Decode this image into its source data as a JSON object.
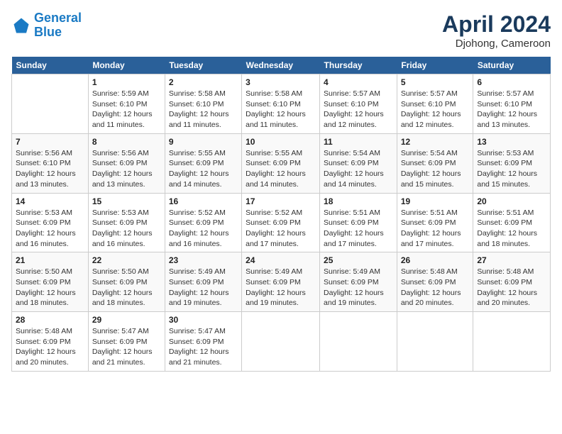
{
  "header": {
    "logo_line1": "General",
    "logo_line2": "Blue",
    "month_title": "April 2024",
    "location": "Djohong, Cameroon"
  },
  "days_of_week": [
    "Sunday",
    "Monday",
    "Tuesday",
    "Wednesday",
    "Thursday",
    "Friday",
    "Saturday"
  ],
  "weeks": [
    [
      {
        "day": "",
        "sunrise": "",
        "sunset": "",
        "daylight": ""
      },
      {
        "day": "1",
        "sunrise": "Sunrise: 5:59 AM",
        "sunset": "Sunset: 6:10 PM",
        "daylight": "Daylight: 12 hours and 11 minutes."
      },
      {
        "day": "2",
        "sunrise": "Sunrise: 5:58 AM",
        "sunset": "Sunset: 6:10 PM",
        "daylight": "Daylight: 12 hours and 11 minutes."
      },
      {
        "day": "3",
        "sunrise": "Sunrise: 5:58 AM",
        "sunset": "Sunset: 6:10 PM",
        "daylight": "Daylight: 12 hours and 11 minutes."
      },
      {
        "day": "4",
        "sunrise": "Sunrise: 5:57 AM",
        "sunset": "Sunset: 6:10 PM",
        "daylight": "Daylight: 12 hours and 12 minutes."
      },
      {
        "day": "5",
        "sunrise": "Sunrise: 5:57 AM",
        "sunset": "Sunset: 6:10 PM",
        "daylight": "Daylight: 12 hours and 12 minutes."
      },
      {
        "day": "6",
        "sunrise": "Sunrise: 5:57 AM",
        "sunset": "Sunset: 6:10 PM",
        "daylight": "Daylight: 12 hours and 13 minutes."
      }
    ],
    [
      {
        "day": "7",
        "sunrise": "Sunrise: 5:56 AM",
        "sunset": "Sunset: 6:10 PM",
        "daylight": "Daylight: 12 hours and 13 minutes."
      },
      {
        "day": "8",
        "sunrise": "Sunrise: 5:56 AM",
        "sunset": "Sunset: 6:09 PM",
        "daylight": "Daylight: 12 hours and 13 minutes."
      },
      {
        "day": "9",
        "sunrise": "Sunrise: 5:55 AM",
        "sunset": "Sunset: 6:09 PM",
        "daylight": "Daylight: 12 hours and 14 minutes."
      },
      {
        "day": "10",
        "sunrise": "Sunrise: 5:55 AM",
        "sunset": "Sunset: 6:09 PM",
        "daylight": "Daylight: 12 hours and 14 minutes."
      },
      {
        "day": "11",
        "sunrise": "Sunrise: 5:54 AM",
        "sunset": "Sunset: 6:09 PM",
        "daylight": "Daylight: 12 hours and 14 minutes."
      },
      {
        "day": "12",
        "sunrise": "Sunrise: 5:54 AM",
        "sunset": "Sunset: 6:09 PM",
        "daylight": "Daylight: 12 hours and 15 minutes."
      },
      {
        "day": "13",
        "sunrise": "Sunrise: 5:53 AM",
        "sunset": "Sunset: 6:09 PM",
        "daylight": "Daylight: 12 hours and 15 minutes."
      }
    ],
    [
      {
        "day": "14",
        "sunrise": "Sunrise: 5:53 AM",
        "sunset": "Sunset: 6:09 PM",
        "daylight": "Daylight: 12 hours and 16 minutes."
      },
      {
        "day": "15",
        "sunrise": "Sunrise: 5:53 AM",
        "sunset": "Sunset: 6:09 PM",
        "daylight": "Daylight: 12 hours and 16 minutes."
      },
      {
        "day": "16",
        "sunrise": "Sunrise: 5:52 AM",
        "sunset": "Sunset: 6:09 PM",
        "daylight": "Daylight: 12 hours and 16 minutes."
      },
      {
        "day": "17",
        "sunrise": "Sunrise: 5:52 AM",
        "sunset": "Sunset: 6:09 PM",
        "daylight": "Daylight: 12 hours and 17 minutes."
      },
      {
        "day": "18",
        "sunrise": "Sunrise: 5:51 AM",
        "sunset": "Sunset: 6:09 PM",
        "daylight": "Daylight: 12 hours and 17 minutes."
      },
      {
        "day": "19",
        "sunrise": "Sunrise: 5:51 AM",
        "sunset": "Sunset: 6:09 PM",
        "daylight": "Daylight: 12 hours and 17 minutes."
      },
      {
        "day": "20",
        "sunrise": "Sunrise: 5:51 AM",
        "sunset": "Sunset: 6:09 PM",
        "daylight": "Daylight: 12 hours and 18 minutes."
      }
    ],
    [
      {
        "day": "21",
        "sunrise": "Sunrise: 5:50 AM",
        "sunset": "Sunset: 6:09 PM",
        "daylight": "Daylight: 12 hours and 18 minutes."
      },
      {
        "day": "22",
        "sunrise": "Sunrise: 5:50 AM",
        "sunset": "Sunset: 6:09 PM",
        "daylight": "Daylight: 12 hours and 18 minutes."
      },
      {
        "day": "23",
        "sunrise": "Sunrise: 5:49 AM",
        "sunset": "Sunset: 6:09 PM",
        "daylight": "Daylight: 12 hours and 19 minutes."
      },
      {
        "day": "24",
        "sunrise": "Sunrise: 5:49 AM",
        "sunset": "Sunset: 6:09 PM",
        "daylight": "Daylight: 12 hours and 19 minutes."
      },
      {
        "day": "25",
        "sunrise": "Sunrise: 5:49 AM",
        "sunset": "Sunset: 6:09 PM",
        "daylight": "Daylight: 12 hours and 19 minutes."
      },
      {
        "day": "26",
        "sunrise": "Sunrise: 5:48 AM",
        "sunset": "Sunset: 6:09 PM",
        "daylight": "Daylight: 12 hours and 20 minutes."
      },
      {
        "day": "27",
        "sunrise": "Sunrise: 5:48 AM",
        "sunset": "Sunset: 6:09 PM",
        "daylight": "Daylight: 12 hours and 20 minutes."
      }
    ],
    [
      {
        "day": "28",
        "sunrise": "Sunrise: 5:48 AM",
        "sunset": "Sunset: 6:09 PM",
        "daylight": "Daylight: 12 hours and 20 minutes."
      },
      {
        "day": "29",
        "sunrise": "Sunrise: 5:47 AM",
        "sunset": "Sunset: 6:09 PM",
        "daylight": "Daylight: 12 hours and 21 minutes."
      },
      {
        "day": "30",
        "sunrise": "Sunrise: 5:47 AM",
        "sunset": "Sunset: 6:09 PM",
        "daylight": "Daylight: 12 hours and 21 minutes."
      },
      {
        "day": "",
        "sunrise": "",
        "sunset": "",
        "daylight": ""
      },
      {
        "day": "",
        "sunrise": "",
        "sunset": "",
        "daylight": ""
      },
      {
        "day": "",
        "sunrise": "",
        "sunset": "",
        "daylight": ""
      },
      {
        "day": "",
        "sunrise": "",
        "sunset": "",
        "daylight": ""
      }
    ]
  ]
}
